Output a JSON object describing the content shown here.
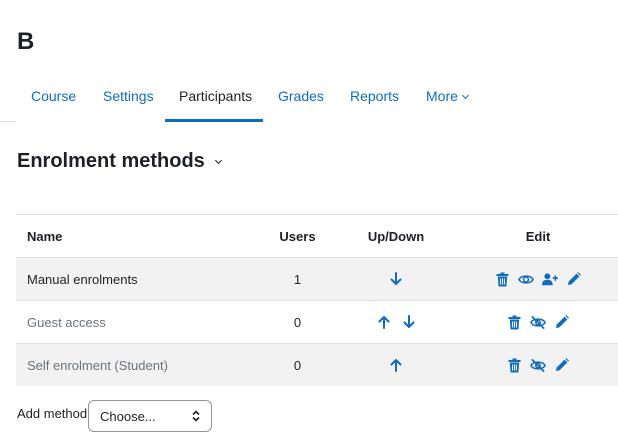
{
  "course": {
    "title": "B"
  },
  "nav": {
    "tabs": [
      {
        "label": "Course"
      },
      {
        "label": "Settings"
      },
      {
        "label": "Participants",
        "active": true
      },
      {
        "label": "Grades"
      },
      {
        "label": "Reports"
      },
      {
        "label": "More"
      }
    ]
  },
  "page": {
    "heading": "Enrolment methods"
  },
  "table": {
    "headers": {
      "name": "Name",
      "users": "Users",
      "updown": "Up/Down",
      "edit": "Edit"
    },
    "rows": [
      {
        "name": "Manual enrolments",
        "users": "1",
        "updown": [
          "down-arrow-icon"
        ],
        "edit": [
          "trash-icon",
          "eye-icon",
          "enrol-users-icon",
          "pencil-icon"
        ],
        "enabled": true
      },
      {
        "name": "Guest access",
        "users": "0",
        "updown": [
          "up-arrow-icon",
          "down-arrow-icon"
        ],
        "edit": [
          "trash-icon",
          "eye-slash-icon",
          "pencil-icon"
        ],
        "enabled": false
      },
      {
        "name": "Self enrolment (Student)",
        "users": "0",
        "updown": [
          "up-arrow-icon"
        ],
        "edit": [
          "trash-icon",
          "eye-slash-icon",
          "pencil-icon"
        ],
        "enabled": false
      }
    ]
  },
  "add_method": {
    "label": "Add method",
    "selected": "Choose..."
  },
  "colors": {
    "accent": "#0f6cbf",
    "text": "#1d2125",
    "muted": "#6a737b",
    "stripe": "#f2f2f2",
    "border": "#dee2e6"
  }
}
